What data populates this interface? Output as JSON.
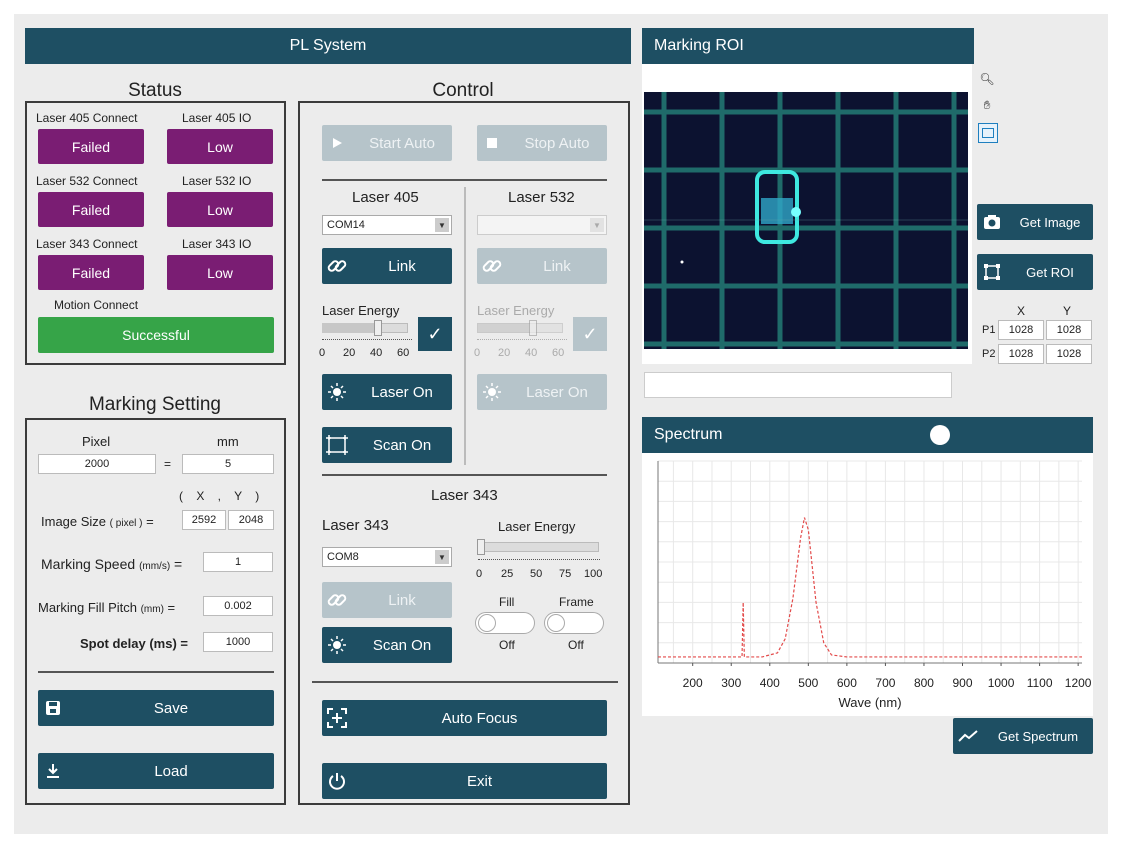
{
  "app": {
    "title": "PL System"
  },
  "status": {
    "title": "Status",
    "rows": [
      {
        "connect_label": "Laser 405 Connect",
        "connect_value": "Failed",
        "io_label": "Laser 405 IO",
        "io_value": "Low"
      },
      {
        "connect_label": "Laser 532 Connect",
        "connect_value": "Failed",
        "io_label": "Laser 532 IO",
        "io_value": "Low"
      },
      {
        "connect_label": "Laser 343 Connect",
        "connect_value": "Failed",
        "io_label": "Laser 343 IO",
        "io_value": "Low"
      }
    ],
    "motion_label": "Motion Connect",
    "motion_value": "Successful"
  },
  "marking": {
    "title": "Marking Setting",
    "pixel_label": "Pixel",
    "mm_label": "mm",
    "pixel_value": "2000",
    "equals": "=",
    "mm_value": "5",
    "xy_header": "( X , Y )",
    "image_size_label": "Image Size",
    "image_size_unit": "( pixel )",
    "image_size_x": "2592",
    "image_size_y": "2048",
    "speed_label": "Marking Speed",
    "speed_unit": "(mm/s)",
    "speed_value": "1",
    "pitch_label": "Marking Fill Pitch",
    "pitch_unit": "(mm)",
    "pitch_value": "0.002",
    "delay_label": "Spot delay (ms)",
    "delay_value": "1000",
    "save_label": "Save",
    "load_label": "Load"
  },
  "control": {
    "title": "Control",
    "start_auto": "Start Auto",
    "stop_auto": "Stop Auto",
    "laser405": {
      "title": "Laser 405",
      "port": "COM14",
      "link": "Link",
      "energy_label": "Laser Energy",
      "energy_value": 0.6,
      "ticks": [
        "0",
        "20",
        "40",
        "60"
      ],
      "laser_on": "Laser On",
      "scan_on": "Scan On"
    },
    "laser532": {
      "title": "Laser 532",
      "port": "",
      "link": "Link",
      "energy_label": "Laser Energy",
      "energy_value": 0.6,
      "ticks": [
        "0",
        "20",
        "40",
        "60"
      ],
      "laser_on": "Laser On"
    },
    "laser343": {
      "title": "Laser 343",
      "sub_title": "Laser 343",
      "port": "COM8",
      "link": "Link",
      "energy_label": "Laser Energy",
      "energy_value": 0.0,
      "ticks": [
        "0",
        "25",
        "50",
        "75",
        "100"
      ],
      "fill_label": "Fill",
      "frame_label": "Frame",
      "fill_state": "Off",
      "frame_state": "Off",
      "scan_on": "Scan On"
    },
    "auto_focus": "Auto Focus",
    "exit": "Exit"
  },
  "roi": {
    "title": "Marking ROI",
    "get_image": "Get Image",
    "get_roi": "Get ROI",
    "col_x": "X",
    "col_y": "Y",
    "p1_label": "P1",
    "p2_label": "P2",
    "p1_x": "1028",
    "p1_y": "1028",
    "p2_x": "1028",
    "p2_y": "1028"
  },
  "spectrum": {
    "title": "Spectrum",
    "xlabel": "Wave (nm)",
    "get_spectrum": "Get Spectrum"
  },
  "chart_data": {
    "type": "line",
    "xlabel": "Wave (nm)",
    "ylabel": "",
    "xlim": [
      110,
      1210
    ],
    "ylim": [
      0,
      1
    ],
    "x_ticks": [
      "200",
      "300",
      "400",
      "500",
      "600",
      "700",
      "800",
      "900",
      "1000",
      "1100",
      "1200"
    ],
    "grid": true,
    "series": [
      {
        "x": [
          110,
          300,
          320,
          328,
          331,
          334,
          340,
          380,
          420,
          440,
          460,
          480,
          490,
          500,
          510,
          520,
          540,
          560,
          600,
          800,
          1000,
          1210
        ],
        "y": [
          0.03,
          0.03,
          0.03,
          0.03,
          0.3,
          0.03,
          0.03,
          0.03,
          0.05,
          0.12,
          0.32,
          0.62,
          0.72,
          0.66,
          0.48,
          0.3,
          0.1,
          0.04,
          0.03,
          0.03,
          0.03,
          0.03
        ]
      }
    ]
  },
  "colors": {
    "accent": "#1e4f63",
    "failed": "#7a1d73",
    "success": "#36a448",
    "spectrum_line": "#e34b4b"
  },
  "icons": [
    "play-icon",
    "stop-icon",
    "link-icon",
    "check-icon",
    "laser-icon",
    "scan-icon",
    "focus-icon",
    "power-icon",
    "save-icon",
    "download-icon",
    "camera-icon",
    "roi-icon",
    "zoom-icon",
    "hand-icon",
    "select-icon",
    "chart-icon"
  ]
}
